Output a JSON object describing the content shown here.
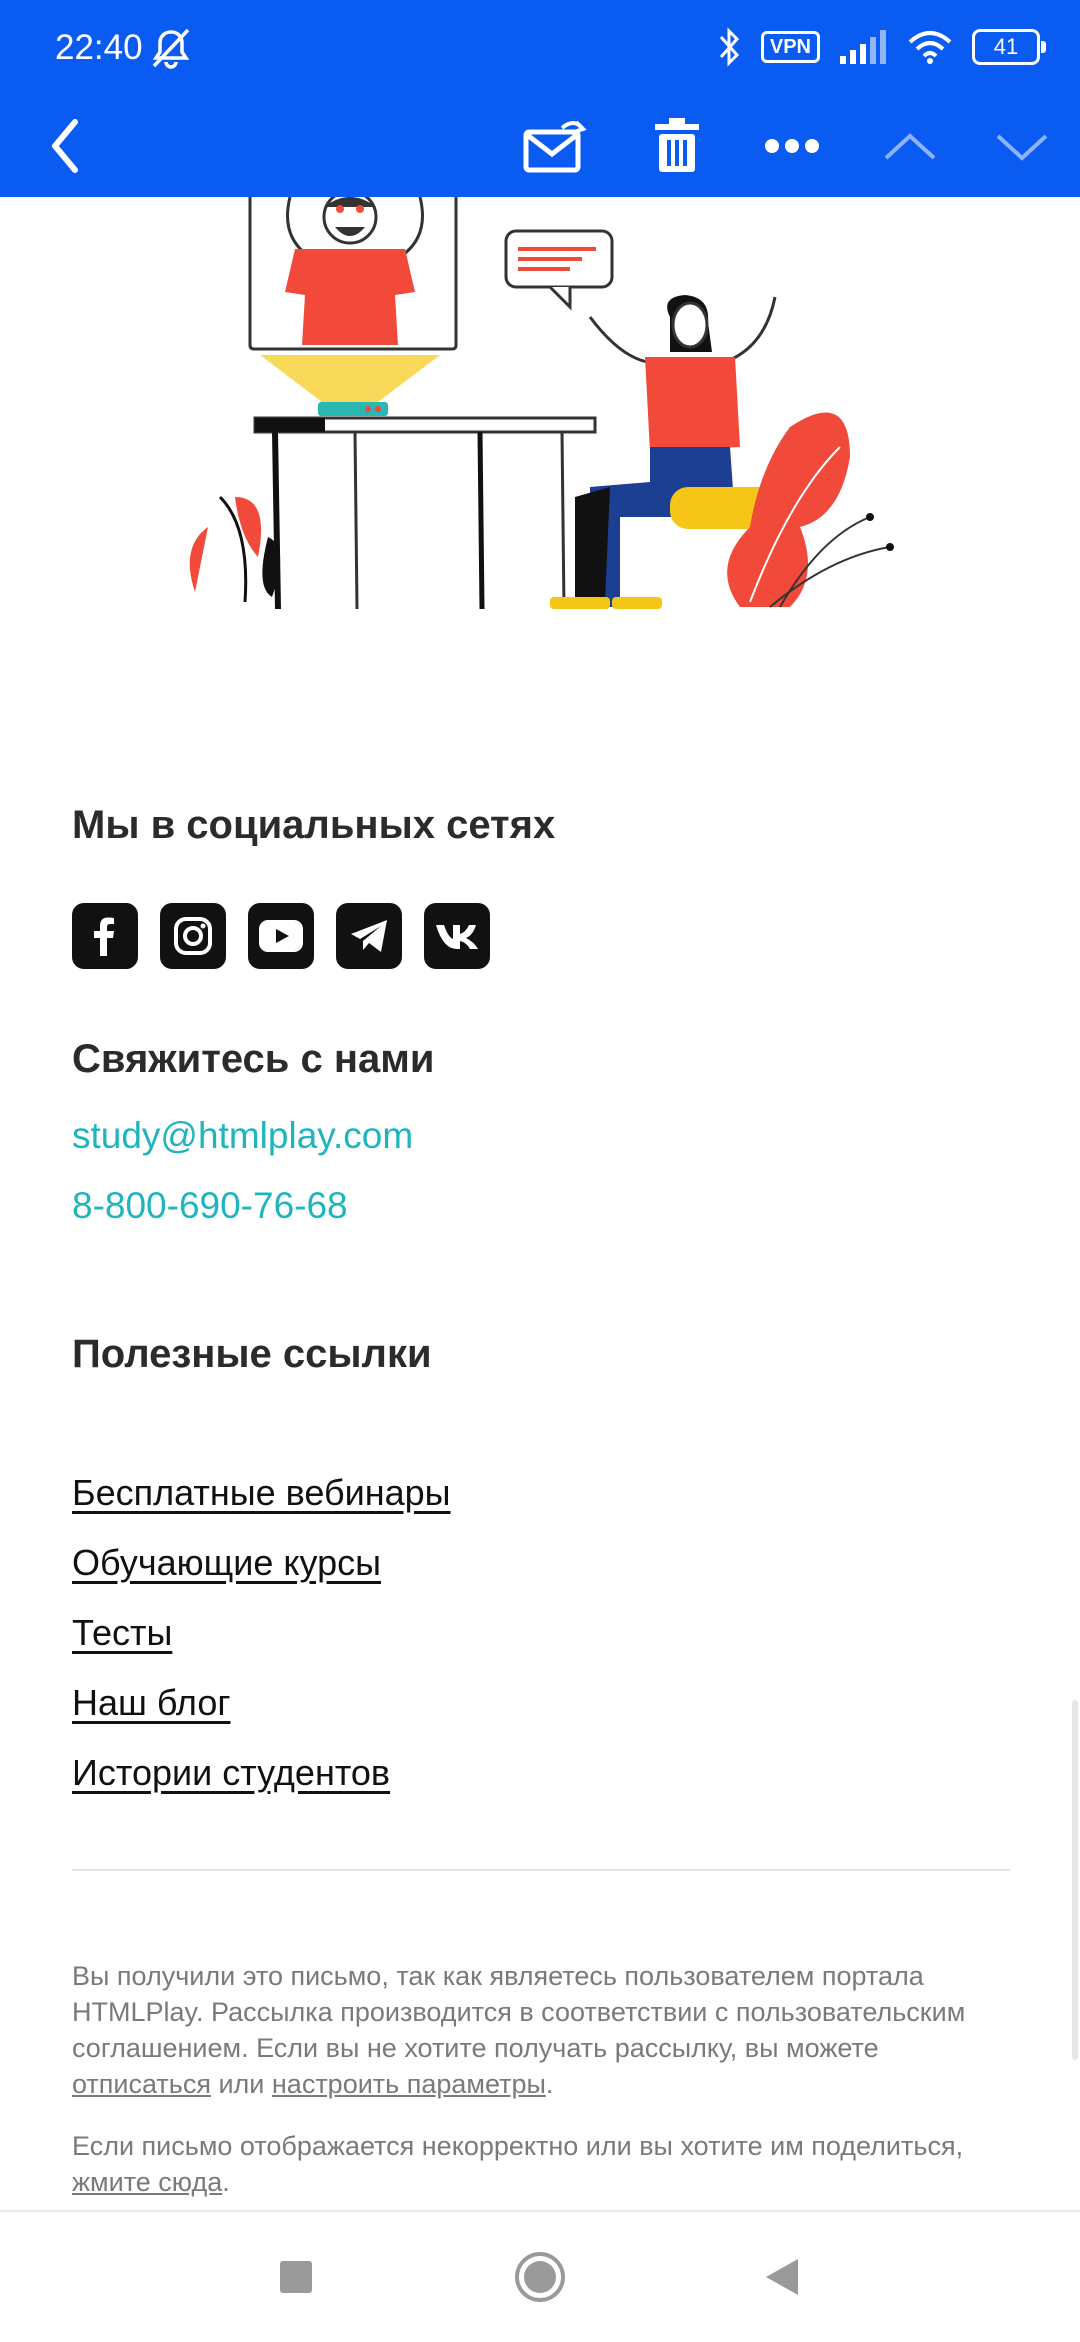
{
  "status_bar": {
    "time": "22:40",
    "vpn_label": "VPN",
    "battery": "41"
  },
  "toolbar": {
    "icons": [
      "back-icon",
      "mark-unread-icon",
      "delete-icon",
      "more-icon",
      "previous-icon",
      "next-icon"
    ]
  },
  "social": {
    "heading": "Мы в социальных сетях",
    "icons": [
      "facebook-icon",
      "instagram-icon",
      "youtube-icon",
      "telegram-icon",
      "vk-icon"
    ]
  },
  "contact": {
    "heading": "Свяжитесь с нами",
    "email": "study@htmlplay.com",
    "phone": "8-800-690-76-68"
  },
  "links": {
    "heading": "Полезные ссылки",
    "items": [
      "Бесплатные вебинары",
      "Обучающие курсы",
      "Тесты",
      "Наш блог",
      "Истории студентов"
    ]
  },
  "footer": {
    "p1_text": "Вы получили это письмо, так как являетесь пользователем портала HTMLPlay. Рассылка производится в соответствии с пользовательским соглашением. Если вы не хотите получать рассылку, вы можете ",
    "unsubscribe": "отписаться",
    "p1_mid": " или ",
    "settings": "настроить параметры",
    "p1_end": ".",
    "p2_text": "Если письмо отображается некорректно или вы хотите им поделиться, ",
    "click_here": "жмите сюда",
    "p2_end": "."
  },
  "colors": {
    "topbar": "#0a5bf2",
    "contact_link": "#1fb5bf",
    "illustration_red": "#f24a3a",
    "illustration_yellow": "#f5c518",
    "illustration_blue": "#1c3f94"
  }
}
